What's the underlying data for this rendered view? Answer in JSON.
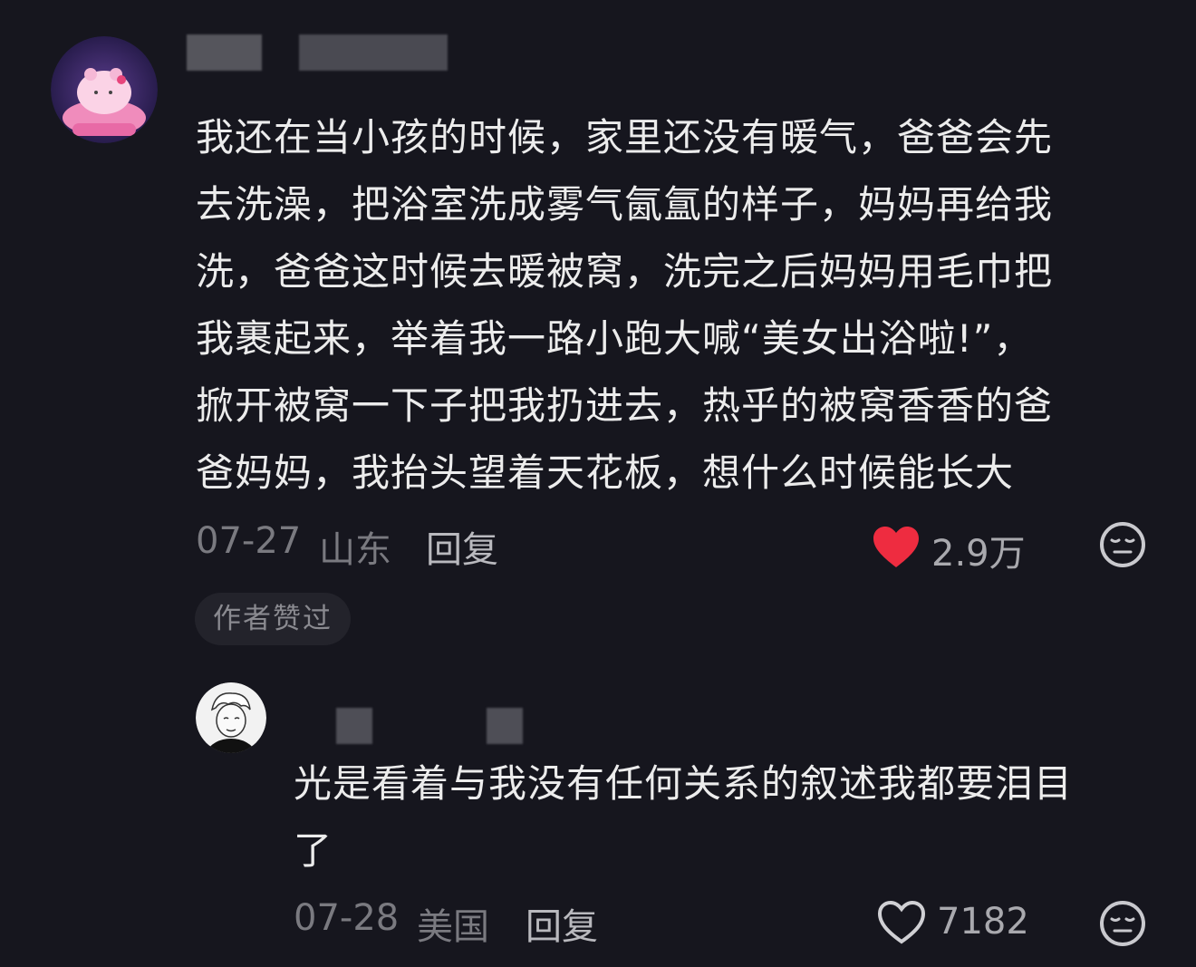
{
  "comments": [
    {
      "text": "我还在当小孩的时候，家里还没有暖气，爸爸会先\n去洗澡，把浴室洗成雾气氤氲的样子，妈妈再给我\n洗，爸爸这时候去暖被窝，洗完之后妈妈用毛巾把\n我裹起来，举着我一路小跑大喊“美女出浴啦!”，\n掀开被窝一下子把我扔进去，热乎的被窝香香的爸\n爸妈妈，我抬头望着天花板，想什么时候能长大",
      "date": "07-27",
      "location": "山东",
      "reply_label": "回复",
      "likes": "2.9万",
      "liked": true,
      "liked_color": "#ee2c40",
      "author_badge": "作者赞过"
    },
    {
      "text": "光是看着与我没有任何关系的叙述我都要泪目\n了",
      "date": "07-28",
      "location": "美国",
      "reply_label": "回复",
      "likes": "7182",
      "liked": false
    }
  ],
  "icons": {
    "like": "heart-icon",
    "dislike": "neutral-face-icon"
  }
}
